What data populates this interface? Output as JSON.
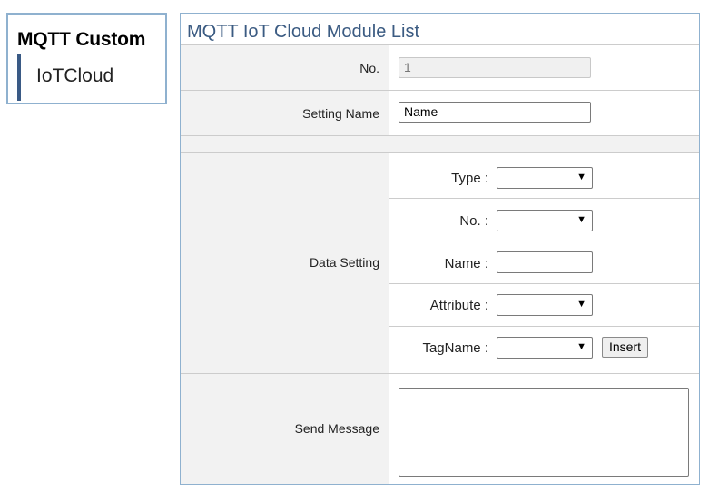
{
  "sidebar": {
    "title": "MQTT Custom",
    "items": [
      {
        "label": "IoTCloud"
      }
    ]
  },
  "panel": {
    "title": "MQTT IoT Cloud Module List",
    "no": {
      "label": "No.",
      "value": "1"
    },
    "setting_name": {
      "label": "Setting Name",
      "value": "Name"
    },
    "data_setting": {
      "label": "Data Setting",
      "type_label": "Type :",
      "no_label": "No. :",
      "name_label": "Name :",
      "attribute_label": "Attribute :",
      "tagname_label": "TagName :",
      "insert_label": "Insert"
    },
    "send_message": {
      "label": "Send Message",
      "value": ""
    }
  },
  "icons": {
    "select_chevron": "chevron-down-icon",
    "resize_grip": "resize-grip-icon"
  },
  "colors": {
    "panel_border": "#8fb1cf",
    "title_blue": "#3b5b82",
    "sidebar_accent": "#3a5a85",
    "label_bg": "#f2f2f2"
  }
}
